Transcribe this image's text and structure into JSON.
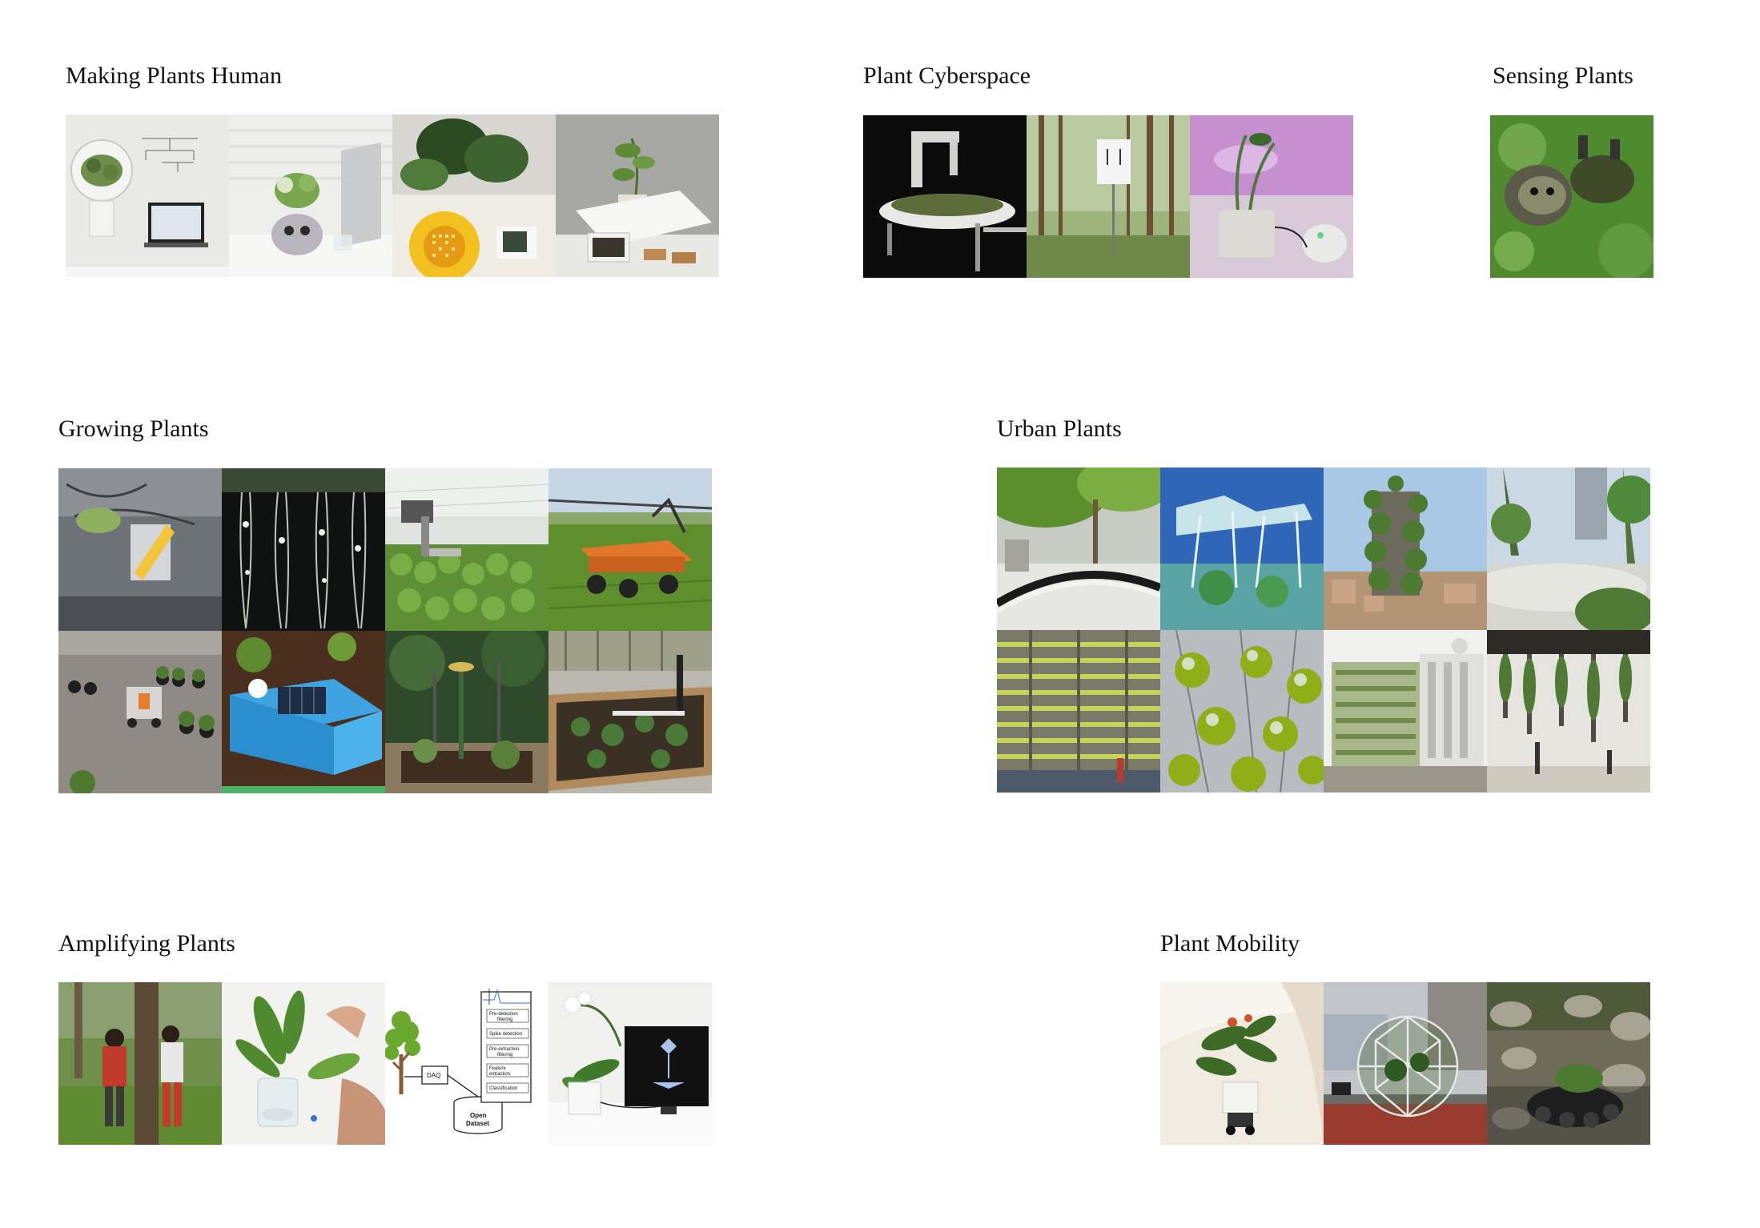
{
  "sections": {
    "making_plants_human": {
      "title": "Making Plants Human",
      "thumbnails": [
        "plant-sensor-dome-photo",
        "plant-robot-pot-photo",
        "led-flower-display-photo",
        "plant-with-display-box-photo"
      ]
    },
    "plant_cyberspace": {
      "title": "Plant Cyberspace",
      "thumbnails": [
        "robot-arm-planter-photo",
        "forest-sign-photo",
        "pink-lit-plant-photo"
      ]
    },
    "sensing_plants": {
      "title": "Sensing Plants",
      "thumbnails": [
        "sensor-drone-photo"
      ]
    },
    "growing_plants": {
      "title": "Growing Plants",
      "thumbnails": [
        "space-station-plant-photo",
        "hanging-roots-photo",
        "robot-gripper-seedlings-photo",
        "field-robot-photo",
        "nursery-robot-photo",
        "solar-sensor-box-photo",
        "garden-sensor-photo",
        "raised-bed-robot-photo"
      ]
    },
    "urban_plants": {
      "title": "Urban Plants",
      "thumbnails": [
        "leafy-canopy-street-photo",
        "tree-structures-photo",
        "vertical-forest-tower-photo",
        "supertree-garden-photo",
        "vertical-farm-photo",
        "algae-bubbles-photo",
        "green-facade-building-photo",
        "hanging-planters-photo"
      ]
    },
    "amplifying_plants": {
      "title": "Amplifying Plants",
      "thumbnails": [
        "people-at-tree-photo",
        "hand-touching-leaf-photo",
        "daq-pipeline-diagram",
        "orchid-with-monitor-photo"
      ],
      "diagram": {
        "daq": "DAQ",
        "open_dataset_line1": "Open",
        "open_dataset_line2": "Dataset",
        "steps": [
          [
            "Pre-detection",
            "filtering"
          ],
          [
            "Spike detection"
          ],
          [
            "Pre-extraction",
            "filtering"
          ],
          [
            "Feature",
            "extraction"
          ],
          [
            "Classification"
          ]
        ]
      }
    },
    "plant_mobility": {
      "title": "Plant Mobility",
      "thumbnails": [
        "plant-on-wheels-photo",
        "geodesic-sphere-photo",
        "rock-crawler-photo"
      ]
    }
  }
}
